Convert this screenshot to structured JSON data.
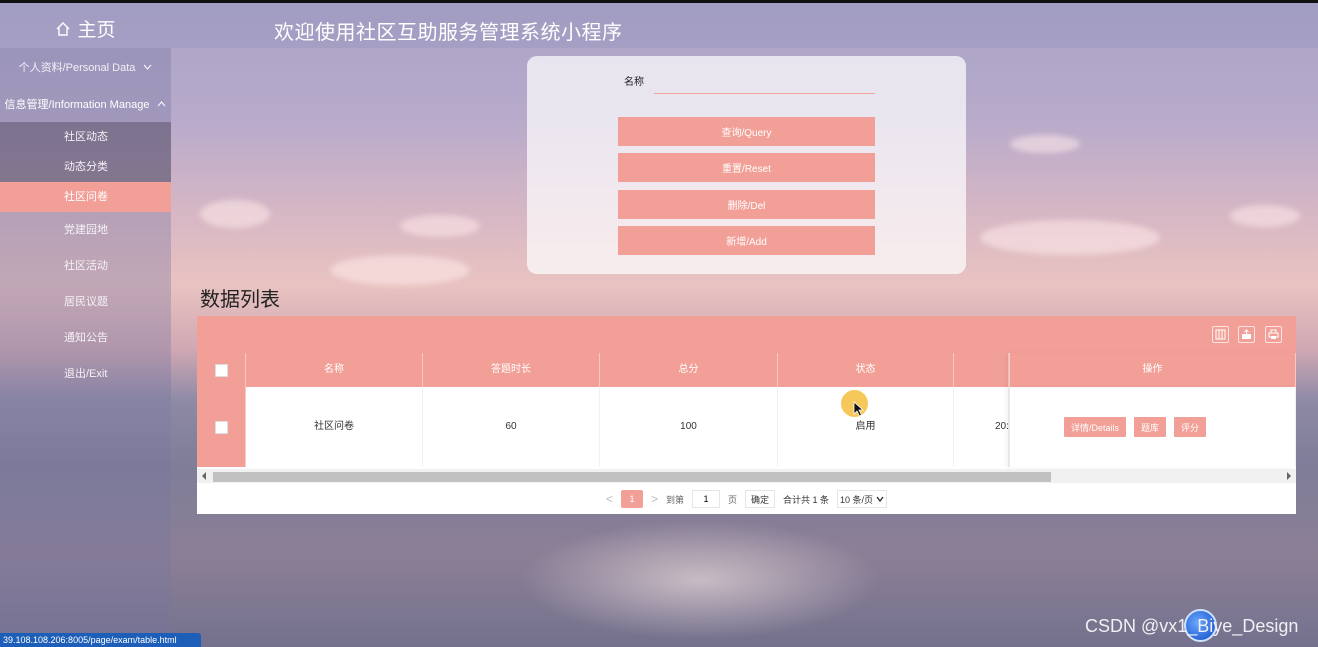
{
  "header": {
    "home_label": "主页",
    "app_title": "欢迎使用社区互助服务管理系统小程序"
  },
  "sidebar": {
    "groups": [
      {
        "label": "个人资料/Personal Data",
        "expanded": false
      },
      {
        "label": "信息管理/Information Manage",
        "expanded": true
      }
    ],
    "items": [
      {
        "label": "社区动态",
        "active": false
      },
      {
        "label": "动态分类",
        "active": false
      },
      {
        "label": "社区问卷",
        "active": true
      },
      {
        "label": "党建园地",
        "active": false
      },
      {
        "label": "社区活动",
        "active": false
      },
      {
        "label": "居民议题",
        "active": false
      },
      {
        "label": "通知公告",
        "active": false
      },
      {
        "label": "退出/Exit",
        "active": false
      }
    ]
  },
  "search": {
    "name_label": "名称",
    "name_value": "",
    "buttons": {
      "query": "查询/Query",
      "reset": "重置/Reset",
      "delete": "删除/Del",
      "add": "新增/Add"
    }
  },
  "list": {
    "title": "数据列表",
    "columns": [
      "名称",
      "答题时长",
      "总分",
      "状态",
      "",
      "操作"
    ],
    "rows": [
      {
        "name": "社区问卷",
        "duration": "60",
        "score": "100",
        "status": "启用",
        "time_partial": "20:",
        "actions": [
          "详情/Details",
          "题库",
          "评分"
        ]
      }
    ]
  },
  "pager": {
    "prev": "<",
    "current": "1",
    "next": ">",
    "goto_label": "到第",
    "goto_value": "1",
    "page_suffix": "页",
    "confirm": "确定",
    "total": "合计共 1 条",
    "page_size": "10 条/页"
  },
  "statusbar": {
    "url": "39.108.108.206:8005/page/exam/table.html"
  },
  "watermark": "CSDN @vx1_Biye_Design",
  "colors": {
    "accent": "#f2a097"
  }
}
